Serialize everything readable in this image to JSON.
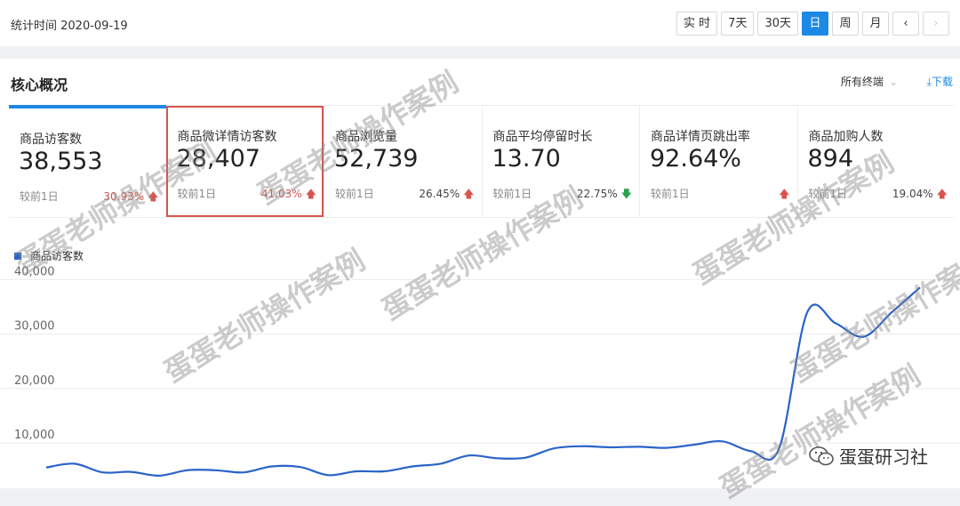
{
  "header": {
    "date_label": "统计时间 2020-09-19",
    "buttons": [
      "实 时",
      "7天",
      "30天",
      "日",
      "周",
      "月",
      "‹",
      "›"
    ],
    "active_index": 3
  },
  "panel": {
    "title": "核心概况",
    "terminal_select": "所有终端",
    "download": "下载"
  },
  "cards": [
    {
      "title": "商品访客数",
      "value": "38,553",
      "compare": "较前1日",
      "pct": "30.93%",
      "trend": "up"
    },
    {
      "title": "商品微详情访客数",
      "value": "28,407",
      "compare": "较前1日",
      "pct": "41.03%",
      "trend": "up"
    },
    {
      "title": "商品浏览量",
      "value": "52,739",
      "compare": "较前1日",
      "pct": "26.45%",
      "trend": "up"
    },
    {
      "title": "商品平均停留时长",
      "value": "13.70",
      "compare": "较前1日",
      "pct": "22.75%",
      "trend": "down"
    },
    {
      "title": "商品详情页跳出率",
      "value": "92.64%",
      "compare": "较前1日",
      "pct": "",
      "trend": "up"
    },
    {
      "title": "商品加购人数",
      "value": "894",
      "compare": "较前1日",
      "pct": "19.04%",
      "trend": "up"
    }
  ],
  "chart_data": {
    "type": "line",
    "series": [
      {
        "name": "商品访客数",
        "color": "#2a63c8",
        "values": [
          5500,
          6200,
          4600,
          4700,
          4000,
          5000,
          5000,
          4600,
          5700,
          5600,
          4100,
          4800,
          4800,
          5700,
          6200,
          7700,
          7200,
          7300,
          9000,
          9400,
          9200,
          9300,
          9100,
          9700,
          10300,
          8500,
          9000,
          34000,
          32000,
          29500,
          34000,
          38553
        ]
      }
    ],
    "y_ticks": [
      "10,000",
      "20,000",
      "30,000",
      "40,000"
    ],
    "ylim": [
      3000,
      43000
    ],
    "grid": true
  },
  "watermarks": [
    "蛋蛋老师操作案例",
    "蛋蛋老师操作案例",
    "蛋蛋老师操作案例",
    "蛋蛋老师操作案例",
    "蛋蛋老师操作案例",
    "蛋蛋老师操作案例",
    "蛋蛋老师操作案例"
  ],
  "brand": "蛋蛋研习社"
}
